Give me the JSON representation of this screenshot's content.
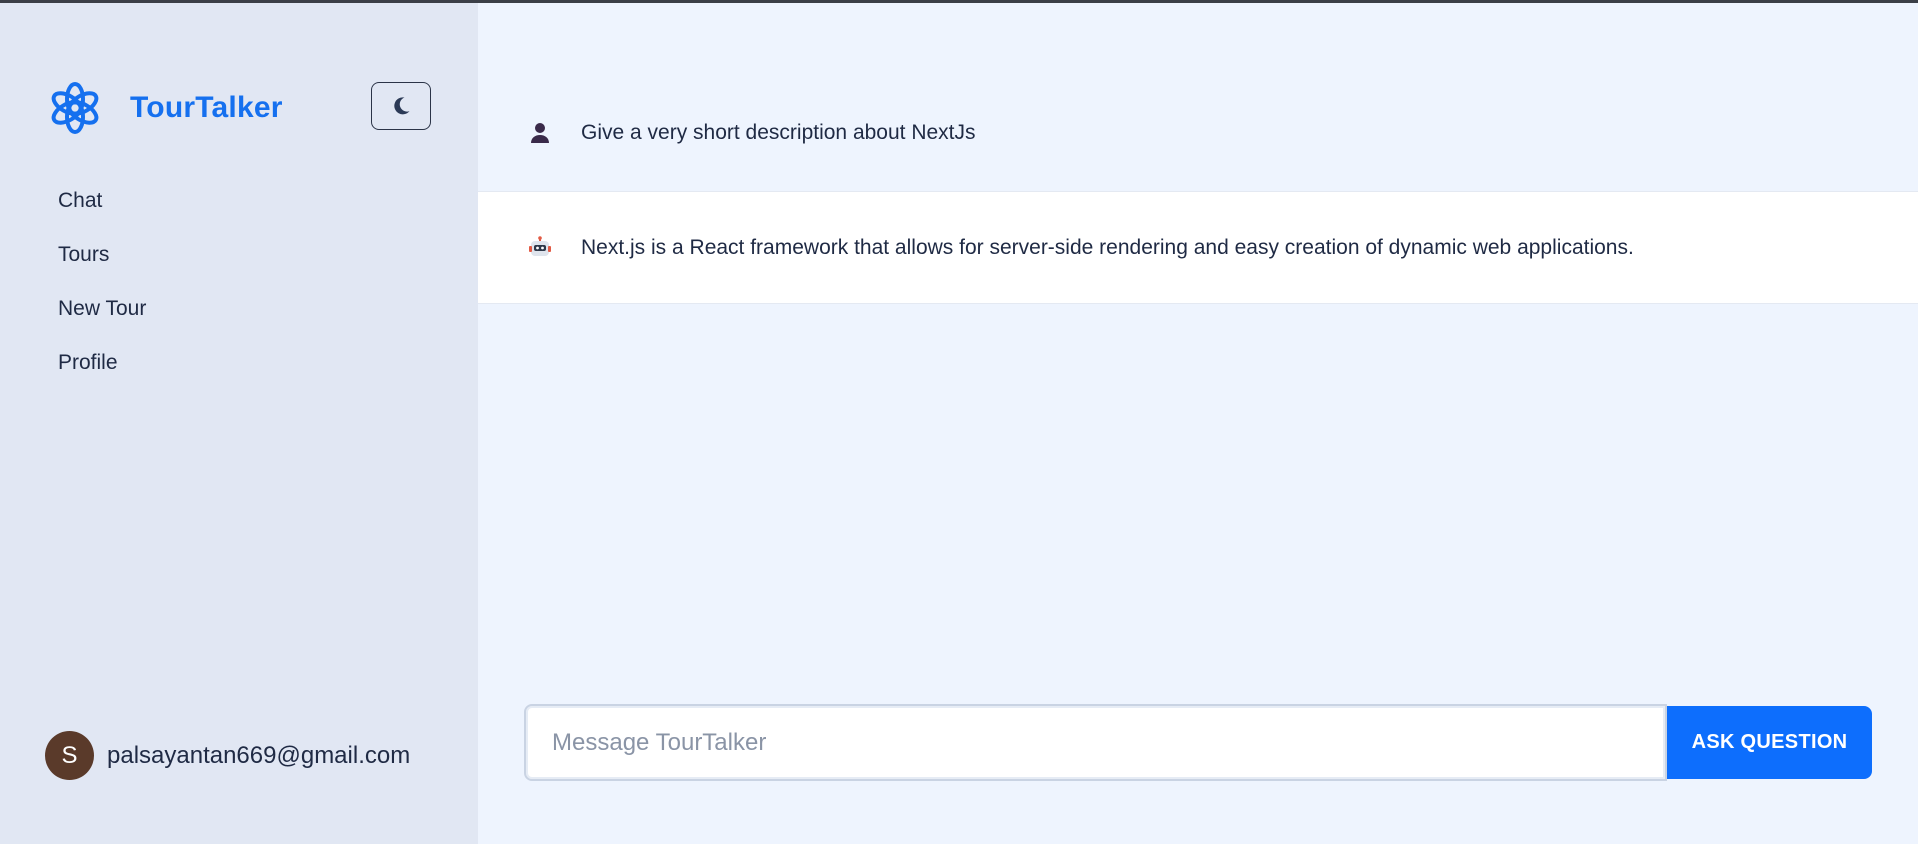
{
  "app": {
    "name": "TourTalker",
    "brand_color": "#1570ef",
    "logo_icon": "openai-knot-icon"
  },
  "sidebar": {
    "theme_toggle_icon": "moon-icon",
    "nav": [
      {
        "label": "Chat"
      },
      {
        "label": "Tours"
      },
      {
        "label": "New Tour"
      },
      {
        "label": "Profile"
      }
    ],
    "user": {
      "initial": "S",
      "email": "palsayantan669@gmail.com"
    }
  },
  "chat": {
    "messages": [
      {
        "role": "user",
        "icon": "user-silhouette-icon",
        "text": "Give a very short description about NextJs"
      },
      {
        "role": "assistant",
        "icon": "robot-icon",
        "text": "Next.js is a React framework that allows for server-side rendering and easy creation of dynamic web applications."
      }
    ],
    "composer": {
      "placeholder": "Message TourTalker",
      "value": "",
      "submit_label": "ASK QUESTION",
      "submit_color": "#0d6efd"
    }
  }
}
